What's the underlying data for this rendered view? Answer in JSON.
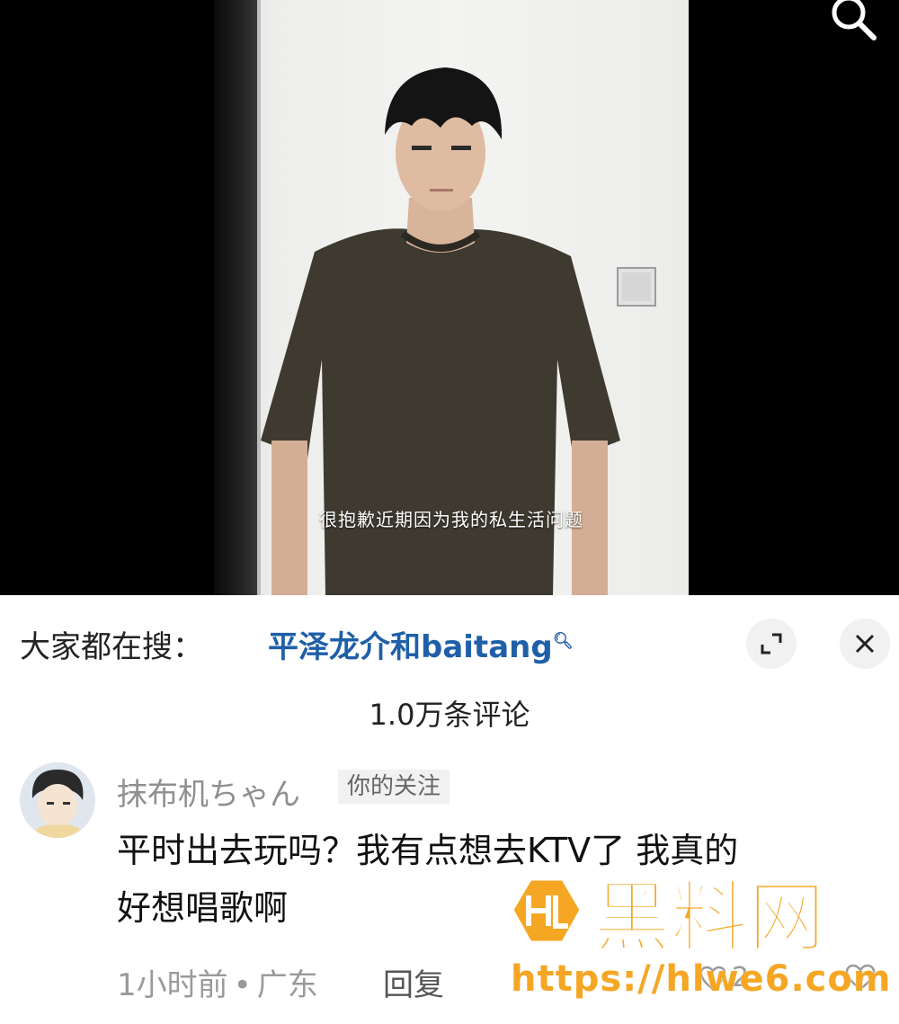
{
  "video": {
    "subtitle": "很抱歉近期因为我的私生活问题"
  },
  "search_suggestion": {
    "label": "大家都在搜：",
    "term": "平泽龙介和baitang",
    "term_icon": "search-icon"
  },
  "controls": {
    "expand_icon": "expand-icon",
    "close_icon": "close-icon"
  },
  "comments": {
    "count_label": "1.0万条评论",
    "items": [
      {
        "user": "抹布机ちゃん",
        "tag": "你的关注",
        "text_line1": "平时出去玩吗？我有点想去KTV了 我真的",
        "text_line2": "好想唱歌啊",
        "time": "1小时前",
        "location": "广东",
        "reply_label": "回复",
        "like_count": "2"
      }
    ]
  },
  "watermark": {
    "brand": "黑料网",
    "url": "https://hlwe6.com",
    "color": "#f5a623"
  },
  "colors": {
    "link": "#1f5fa8",
    "muted": "#9a9a9a"
  }
}
